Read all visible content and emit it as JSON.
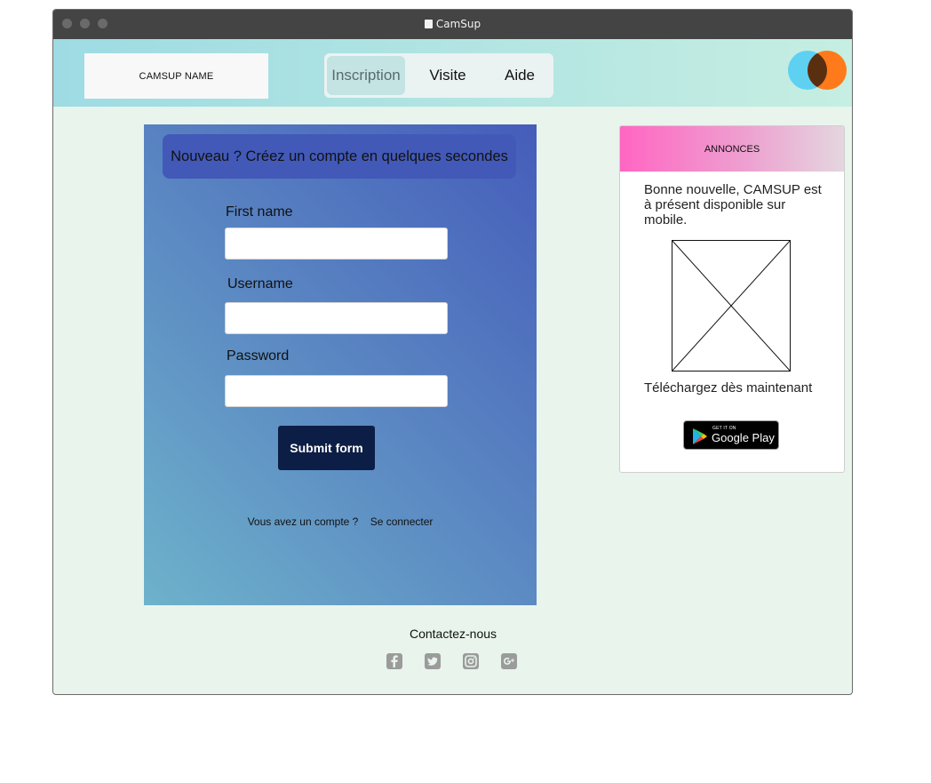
{
  "window": {
    "title": "CamSup"
  },
  "header": {
    "logo_text": "CAMSUP NAME",
    "nav": [
      {
        "label": "Inscription",
        "active": true
      },
      {
        "label": "Visite",
        "active": false
      },
      {
        "label": "Aide",
        "active": false
      }
    ],
    "brand_icon": "overlapping-circles-logo"
  },
  "form": {
    "banner": "Nouveau ? Créez un compte en quelques secondes",
    "fields": [
      {
        "label": "First name",
        "value": "",
        "placeholder": ""
      },
      {
        "label": "Username",
        "value": "",
        "placeholder": ""
      },
      {
        "label": "Password",
        "value": "",
        "placeholder": ""
      }
    ],
    "submit_label": "Submit form",
    "account_question": "Vous avez un compte ?",
    "login_link": "Se connecter"
  },
  "announcements": {
    "title": "ANNONCES",
    "text": "Bonne nouvelle, CAMSUP est à présent disponible sur mobile.",
    "image_icon": "image-placeholder",
    "cta": "Téléchargez dès maintenant",
    "store_badge_small": "GET IT ON",
    "store_badge_big": "Google Play"
  },
  "footer": {
    "contact_title": "Contactez-nous",
    "social_icons": [
      "facebook-icon",
      "twitter-icon",
      "instagram-icon",
      "google-plus-icon"
    ]
  },
  "colors": {
    "header_gradient": [
      "#9edbe3",
      "#c6eee2"
    ],
    "form_gradient": [
      "#455dba",
      "#6eb2cb"
    ],
    "announcement_gradient": [
      "#ff66c2",
      "#e4d6df"
    ],
    "submit": "#0c1e45",
    "page_bg": "#e8f4ec"
  }
}
